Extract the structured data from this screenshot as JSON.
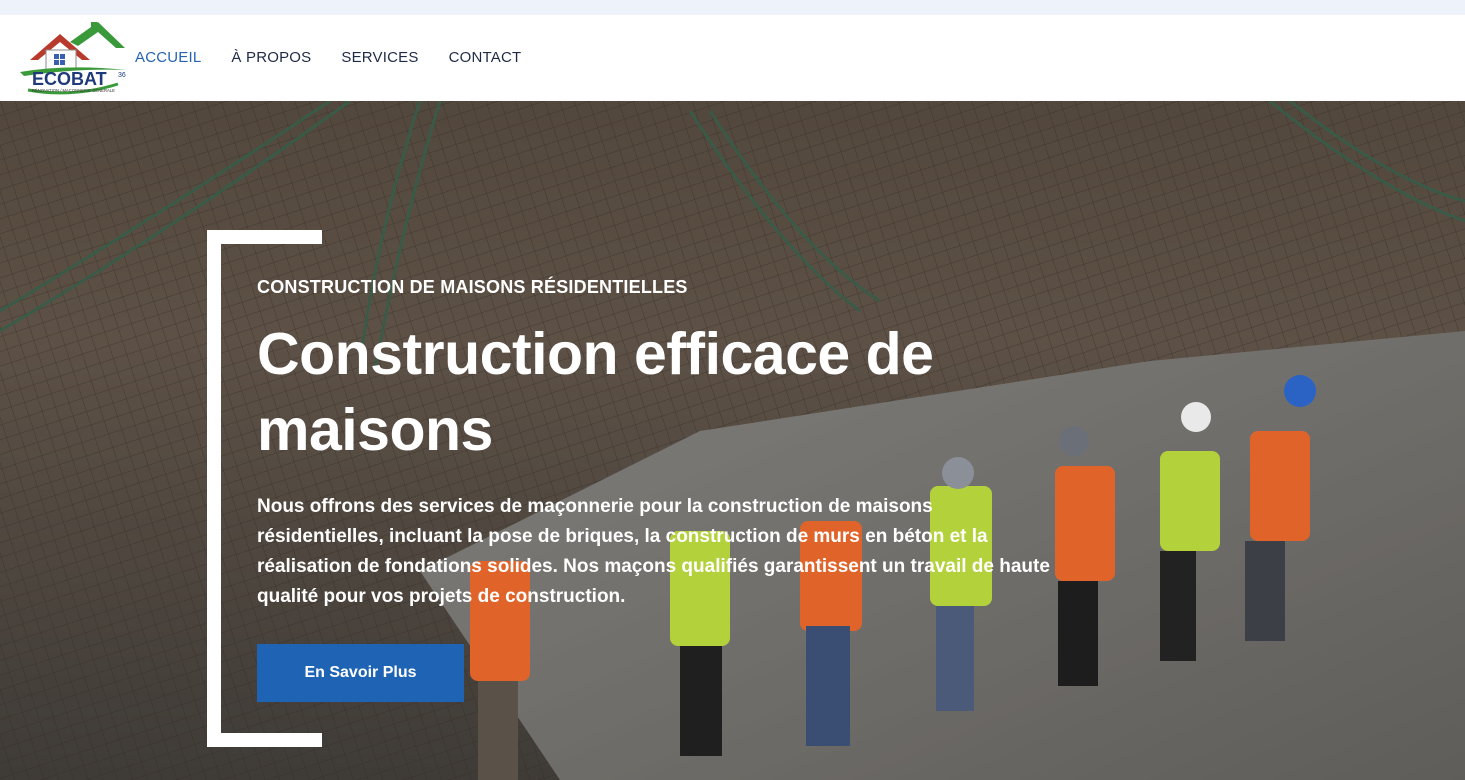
{
  "brand": {
    "logo_text": "ECOBAT",
    "logo_superscript": "36",
    "logo_tagline": "RÉNOVATION / MAÇONNERIE GÉNÉRALE"
  },
  "nav": {
    "items": [
      {
        "label": "ACCUEIL",
        "active": true
      },
      {
        "label": "À PROPOS",
        "active": false
      },
      {
        "label": "SERVICES",
        "active": false
      },
      {
        "label": "CONTACT",
        "active": false
      }
    ]
  },
  "hero": {
    "eyebrow": "CONSTRUCTION DE MAISONS RÉSIDENTIELLES",
    "title": "Construction efficace de maisons",
    "description": "Nous offrons des services de maçonnerie pour la construction de maisons résidentielles, incluant la pose de briques, la construction de murs en béton et la réalisation de fondations solides. Nos maçons qualifiés garantissent un travail de haute qualité pour vos projets de construction.",
    "cta_label": "En Savoir Plus",
    "background": "construction-site-workers-photo"
  },
  "colors": {
    "accent": "#1f64b4",
    "nav_active": "#2563b0",
    "nav_text": "#1f2a44",
    "top_strip": "#eef2fb"
  }
}
